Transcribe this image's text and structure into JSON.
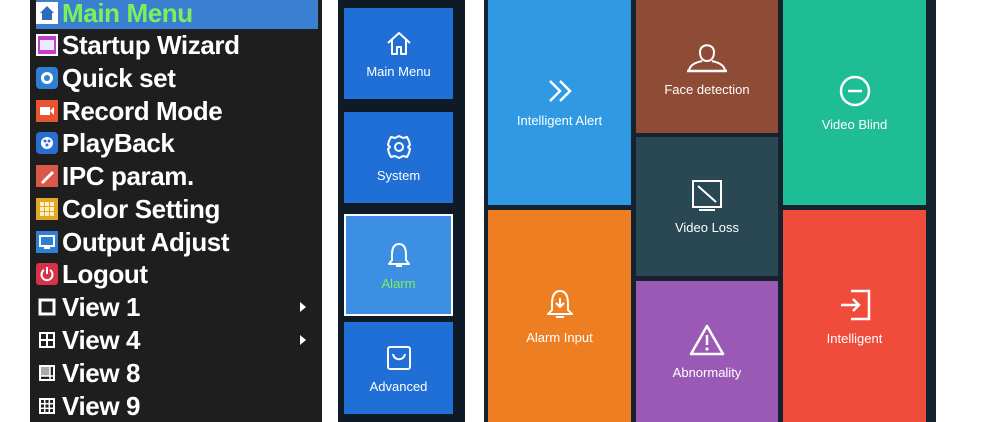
{
  "menu": {
    "items": [
      {
        "label": "Main Menu",
        "icon": "home-icon"
      },
      {
        "label": "Startup Wizard",
        "icon": "wizard-icon"
      },
      {
        "label": "Quick set",
        "icon": "quick-set-icon"
      },
      {
        "label": "Record Mode",
        "icon": "record-icon"
      },
      {
        "label": "PlayBack",
        "icon": "playback-icon"
      },
      {
        "label": "IPC param.",
        "icon": "ipc-param-icon"
      },
      {
        "label": "Color Setting",
        "icon": "color-setting-icon"
      },
      {
        "label": "Output Adjust",
        "icon": "output-adjust-icon"
      },
      {
        "label": "Logout",
        "icon": "power-icon"
      },
      {
        "label": "View 1",
        "icon": "view-1-icon"
      },
      {
        "label": "View 4",
        "icon": "view-4-icon"
      },
      {
        "label": "View 8",
        "icon": "view-8-icon"
      },
      {
        "label": "View 9",
        "icon": "view-9-icon"
      }
    ],
    "selected": "Main Menu",
    "highlight_color": "#3b7fd0",
    "selected_text_color": "#7cf05a"
  },
  "nav": {
    "items": [
      {
        "label": "Main Menu",
        "icon": "home-icon"
      },
      {
        "label": "System",
        "icon": "gear-icon"
      },
      {
        "label": "Alarm",
        "icon": "bell-icon"
      },
      {
        "label": "Advanced",
        "icon": "bag-icon"
      }
    ],
    "selected": "Alarm"
  },
  "tiles": [
    {
      "label": "Intelligent Alert",
      "icon": "double-chevron-icon",
      "color": "#2f9ae3"
    },
    {
      "label": "Face detection",
      "icon": "face-icon",
      "color": "#8e4b36"
    },
    {
      "label": "Video Blind",
      "icon": "minus-circle-icon",
      "color": "#1fbd93"
    },
    {
      "label": "Video Loss",
      "icon": "video-loss-icon",
      "color": "#2a4754"
    },
    {
      "label": "Alarm Input",
      "icon": "alarm-input-icon",
      "color": "#ed7e22"
    },
    {
      "label": "Abnormality",
      "icon": "warning-icon",
      "color": "#9b59b6"
    },
    {
      "label": "Intelligent",
      "icon": "enter-icon",
      "color": "#ef4c3c"
    }
  ]
}
